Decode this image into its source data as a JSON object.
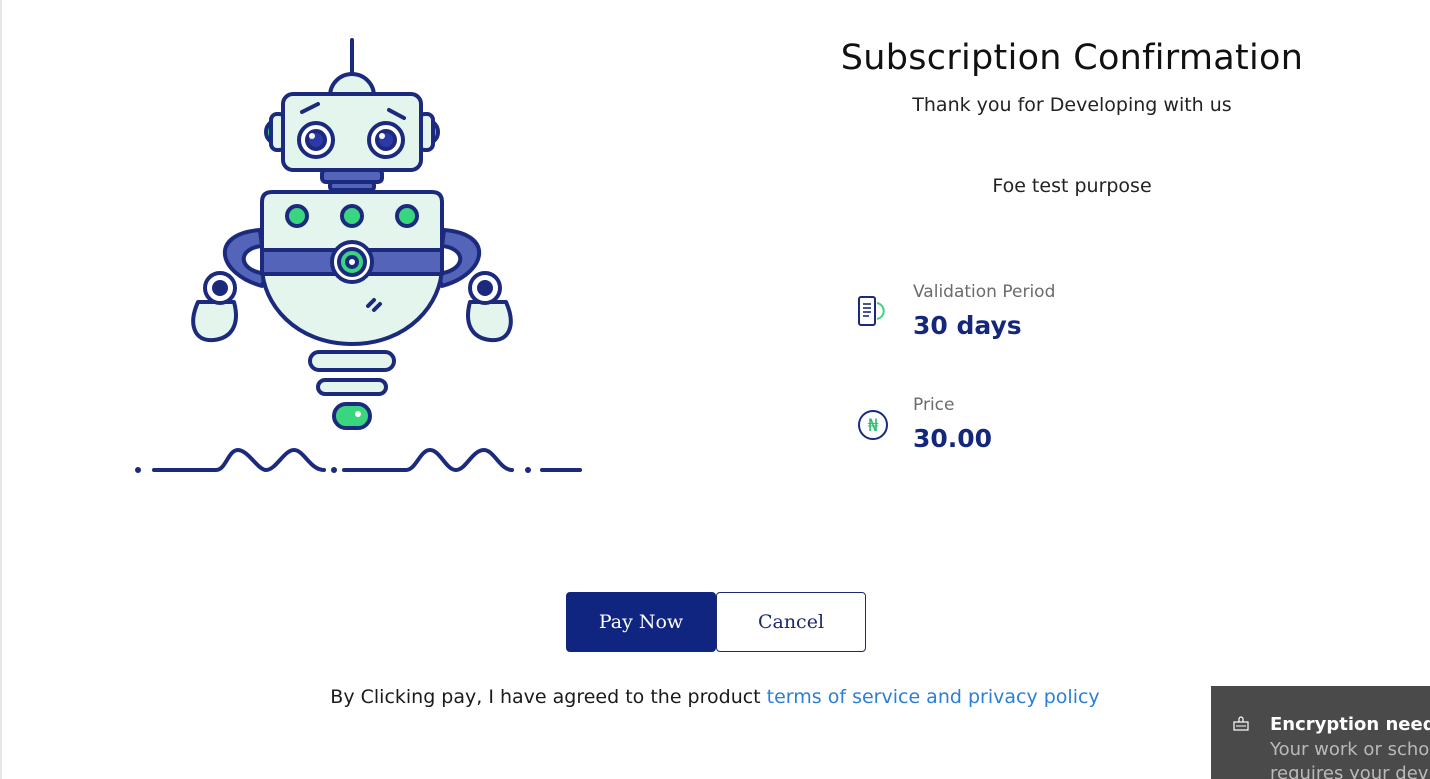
{
  "page": {
    "title": "Subscription Confirmation",
    "subtitle": "Thank you for Developing with us",
    "description": "Foe test purpose"
  },
  "details": {
    "validation": {
      "label": "Validation Period",
      "value": "30 days",
      "icon": "document-phone-icon"
    },
    "price": {
      "label": "Price",
      "value": "30.00",
      "icon": "naira-currency-icon",
      "currency_symbol": "₦"
    }
  },
  "actions": {
    "pay_label": "Pay Now",
    "cancel_label": "Cancel"
  },
  "agreement": {
    "text": "By Clicking pay, I have agreed to the product ",
    "link_text": "terms of service and privacy policy"
  },
  "toast": {
    "title": "Encryption needed",
    "body": "Your work or school account requires your device to be encrypted. Select"
  },
  "colors": {
    "primary": "#102580",
    "accent_green": "#3ad67f",
    "link": "#2a7fd6",
    "robot_body": "#e3f5ec"
  }
}
